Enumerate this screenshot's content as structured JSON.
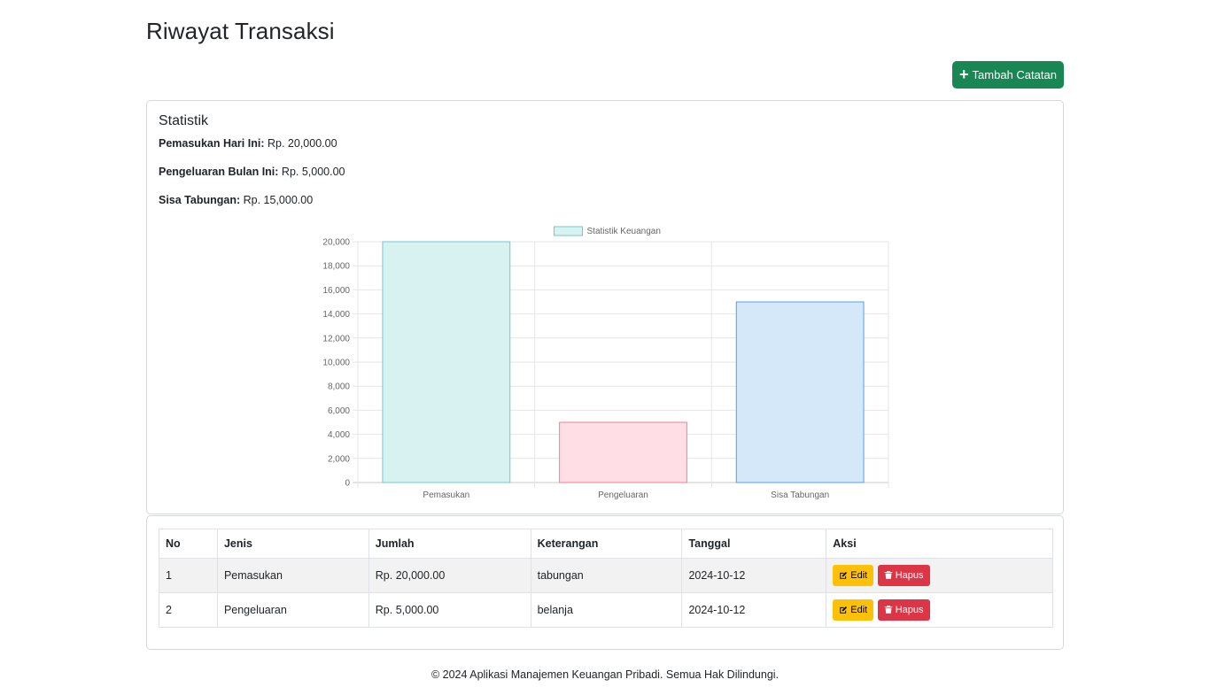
{
  "page": {
    "title": "Riwayat Transaksi",
    "add_button_label": "Tambah Catatan",
    "footer": "© 2024 Aplikasi Manajemen Keuangan Pribadi. Semua Hak Dilindungi."
  },
  "stats": {
    "title": "Statistik",
    "income_label": "Pemasukan Hari Ini:",
    "income_value": "Rp. 20,000.00",
    "expense_label": "Pengeluaran Bulan Ini:",
    "expense_value": "Rp. 5,000.00",
    "savings_label": "Sisa Tabungan:",
    "savings_value": "Rp. 15,000.00"
  },
  "chart_data": {
    "type": "bar",
    "categories": [
      "Pemasukan",
      "Pengeluaran",
      "Sisa Tabungan"
    ],
    "series": [
      {
        "name": "Statistik Keuangan",
        "values": [
          20000,
          5000,
          15000
        ]
      }
    ],
    "ylim": [
      0,
      20000
    ],
    "yticks": [
      0,
      2000,
      4000,
      6000,
      8000,
      10000,
      12000,
      14000,
      16000,
      18000,
      20000
    ],
    "ytick_labels": [
      "0",
      "2,000",
      "4,000",
      "6,000",
      "8,000",
      "10,000",
      "12,000",
      "14,000",
      "16,000",
      "18,000",
      "20,000"
    ],
    "grid": true,
    "legend": "top",
    "bar_fills": [
      "#d8f1f1",
      "#ffdfe5",
      "#d4e8f9"
    ],
    "bar_strokes": [
      "#6fcbcb",
      "#f37d96",
      "#4ba3e6"
    ]
  },
  "table": {
    "headers": [
      "No",
      "Jenis",
      "Jumlah",
      "Keterangan",
      "Tanggal",
      "Aksi"
    ],
    "rows": [
      {
        "no": "1",
        "jenis": "Pemasukan",
        "jumlah": "Rp. 20,000.00",
        "keterangan": "tabungan",
        "tanggal": "2024-10-12"
      },
      {
        "no": "2",
        "jenis": "Pengeluaran",
        "jumlah": "Rp. 5,000.00",
        "keterangan": "belanja",
        "tanggal": "2024-10-12"
      }
    ],
    "edit_label": "Edit",
    "delete_label": "Hapus"
  }
}
